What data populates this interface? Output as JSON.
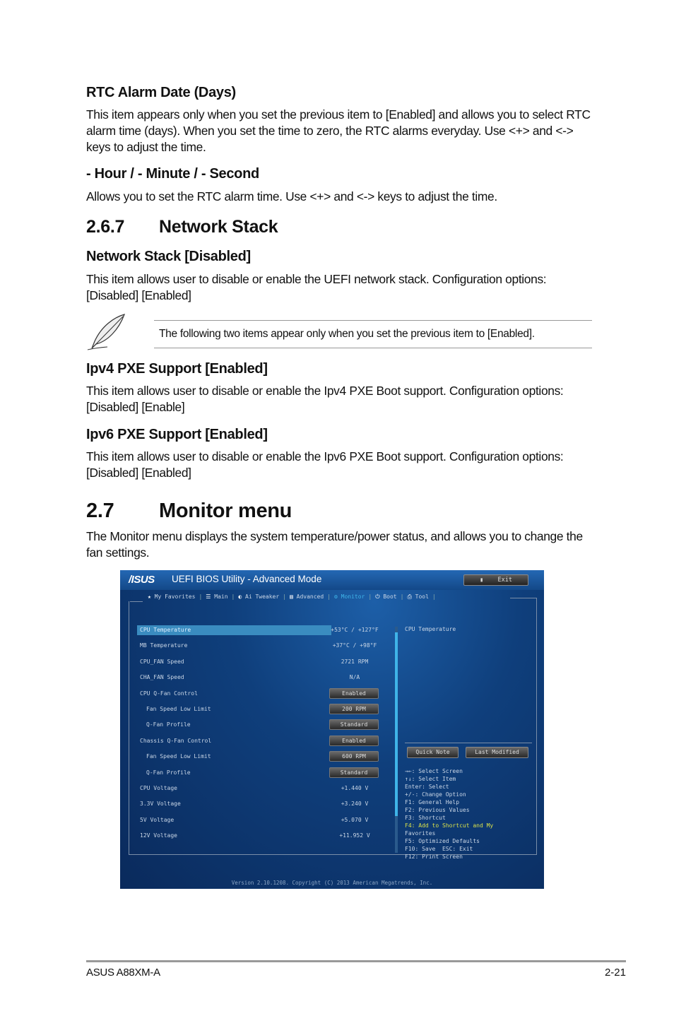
{
  "sections": {
    "rtc_date": {
      "heading": "RTC Alarm Date (Days)",
      "body": "This item appears only when you set the previous item to [Enabled] and allows you to select RTC alarm time (days). When you set the time to zero, the RTC alarms everyday. Use <+> and <-> keys to adjust the time."
    },
    "hour": {
      "heading": "- Hour / - Minute / - Second",
      "body": "Allows you to set the RTC alarm time. Use <+> and <-> keys to adjust the time."
    },
    "netstack": {
      "number": "2.6.7",
      "title": "Network Stack"
    },
    "netstack_item": {
      "heading": "Network Stack [Disabled]",
      "body": "This item allows user to disable or enable the UEFI network stack. Configuration options: [Disabled] [Enabled]"
    },
    "note": {
      "text": "The following two items appear only when you set the previous item to [Enabled].",
      "icon": "quill-pen-icon"
    },
    "ipv4": {
      "heading": "Ipv4 PXE Support [Enabled]",
      "body": "This item allows user to disable or enable the Ipv4 PXE Boot support. Configuration options: [Disabled] [Enable]"
    },
    "ipv6": {
      "heading": "Ipv6 PXE Support [Enabled]",
      "body": "This item allows user to disable or enable the Ipv6 PXE Boot support. Configuration options: [Disabled] [Enabled]"
    },
    "monitor": {
      "number": "2.7",
      "title": "Monitor menu",
      "body": "The Monitor menu displays the system temperature/power status, and allows you to change the fan settings."
    }
  },
  "bios": {
    "logo": "/ISUS",
    "title": "UEFI BIOS Utility - Advanced Mode",
    "exit": "Exit",
    "tabs": [
      {
        "label": "My Favorites",
        "icon": "★"
      },
      {
        "label": "Main",
        "icon": "☰"
      },
      {
        "label": "Ai Tweaker",
        "icon": "◐"
      },
      {
        "label": "Advanced",
        "icon": "▤"
      },
      {
        "label": "Monitor",
        "icon": "⚙",
        "active": true
      },
      {
        "label": "Boot",
        "icon": "⏻"
      },
      {
        "label": "Tool",
        "icon": "⎙"
      }
    ],
    "rows": [
      {
        "label": "CPU Temperature",
        "value": "+53°C / +127°F",
        "selected": true
      },
      {
        "label": "MB Temperature",
        "value": "+37°C / +98°F"
      },
      {
        "label": "CPU_FAN Speed",
        "value": "2721 RPM"
      },
      {
        "label": "CHA_FAN Speed",
        "value": "N/A"
      },
      {
        "label": "CPU Q-Fan Control",
        "value": "Enabled",
        "button": true
      },
      {
        "label": "Fan Speed Low Limit",
        "value": "200 RPM",
        "button": true,
        "indent": true
      },
      {
        "label": "Q-Fan Profile",
        "value": "Standard",
        "button": true,
        "indent": true
      },
      {
        "label": "Chassis Q-Fan Control",
        "value": "Enabled",
        "button": true
      },
      {
        "label": "Fan Speed Low Limit",
        "value": "600 RPM",
        "button": true,
        "indent": true
      },
      {
        "label": "Q-Fan Profile",
        "value": "Standard",
        "button": true,
        "indent": true
      },
      {
        "label": "CPU Voltage",
        "value": "+1.440 V"
      },
      {
        "label": "3.3V Voltage",
        "value": "+3.240 V"
      },
      {
        "label": "5V Voltage",
        "value": "+5.070 V"
      },
      {
        "label": "12V Voltage",
        "value": "+11.952 V"
      }
    ],
    "help_title": "CPU Temperature",
    "quick_note": "Quick Note",
    "last_modified": "Last Modified",
    "help": [
      {
        "text": "→←: Select Screen"
      },
      {
        "text": "↑↓: Select Item"
      },
      {
        "text": "Enter: Select"
      },
      {
        "text": "+/-: Change Option"
      },
      {
        "text": "F1: General Help"
      },
      {
        "text": "F2: Previous Values"
      },
      {
        "text": "F3: Shortcut"
      },
      {
        "text": "F4: Add to Shortcut and My",
        "highlight": true
      },
      {
        "text": "Favorites"
      },
      {
        "text": "F5: Optimized Defaults"
      },
      {
        "text": "F10: Save  ESC: Exit"
      },
      {
        "text": "F12: Print Screen"
      }
    ],
    "version": "Version 2.10.1208. Copyright (C) 2013 American Megatrends, Inc.",
    "colors": {
      "highlight": "#d8e04a",
      "accent": "#3fb4e8",
      "selected_row": "#3a8cc0"
    }
  },
  "footer": {
    "left": "ASUS A88XM-A",
    "right": "2-21"
  }
}
